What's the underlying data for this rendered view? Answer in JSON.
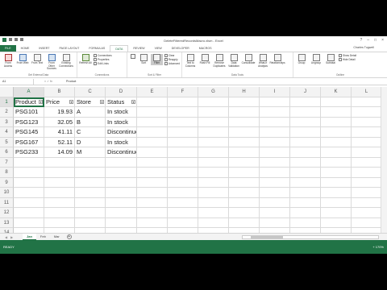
{
  "window": {
    "title": "DeleteFilteredRecordsMacro.xlsm - Excel"
  },
  "tabs": [
    "FILE",
    "HOME",
    "INSERT",
    "PAGE LAYOUT",
    "FORMULAS",
    "DATA",
    "REVIEW",
    "VIEW",
    "DEVELOPER",
    "MACROS"
  ],
  "active_tab": "DATA",
  "user": "Charles Tugwell",
  "ribbon": {
    "external": {
      "label": "Get External Data",
      "b1": "From Access",
      "b2": "From Web",
      "b3": "From Text",
      "b4": "From Other Sources",
      "b5": "Existing Connections"
    },
    "connections": {
      "label": "Connections",
      "refresh": "Refresh All",
      "s1": "Connections",
      "s2": "Properties",
      "s3": "Edit Links"
    },
    "sort": {
      "label": "Sort & Filter",
      "sort": "Sort",
      "filter": "Filter",
      "s1": "Clear",
      "s2": "Reapply",
      "s3": "Advanced"
    },
    "tools": {
      "label": "Data Tools",
      "b1": "Text to Columns",
      "b2": "Flash Fill",
      "b3": "Remove Duplicates",
      "b4": "Data Validation",
      "b5": "Consolidate",
      "b6": "What-If Analysis",
      "b7": "Relationships"
    },
    "outline": {
      "label": "Outline",
      "b1": "Group",
      "b2": "Ungroup",
      "b3": "Subtotal",
      "s1": "Show Detail",
      "s2": "Hide Detail"
    }
  },
  "formula_bar": {
    "name_box": "A1",
    "fx": "× ✓ fx",
    "value": "Product"
  },
  "columns": [
    "A",
    "B",
    "C",
    "D",
    "E",
    "F",
    "G",
    "H",
    "I",
    "J",
    "K",
    "L"
  ],
  "rows": [
    "1",
    "2",
    "3",
    "4",
    "5",
    "6",
    "7",
    "8",
    "9",
    "10",
    "11",
    "12",
    "13",
    "14"
  ],
  "header": [
    "Product",
    "Price",
    "Store",
    "Status"
  ],
  "data": [
    [
      "PSG101",
      "19.93",
      "A",
      "In stock"
    ],
    [
      "PSG123",
      "32.05",
      "B",
      "In stock"
    ],
    [
      "PSG145",
      "41.11",
      "C",
      "Discontinued"
    ],
    [
      "PSG167",
      "52.11",
      "D",
      "In stock"
    ],
    [
      "PSG233",
      "14.09",
      "M",
      "Discontinued"
    ]
  ],
  "sheets": [
    "Jan",
    "Feb",
    "Mar"
  ],
  "active_sheet": "Jan",
  "status": {
    "left": "READY",
    "right": "+ 170%"
  }
}
